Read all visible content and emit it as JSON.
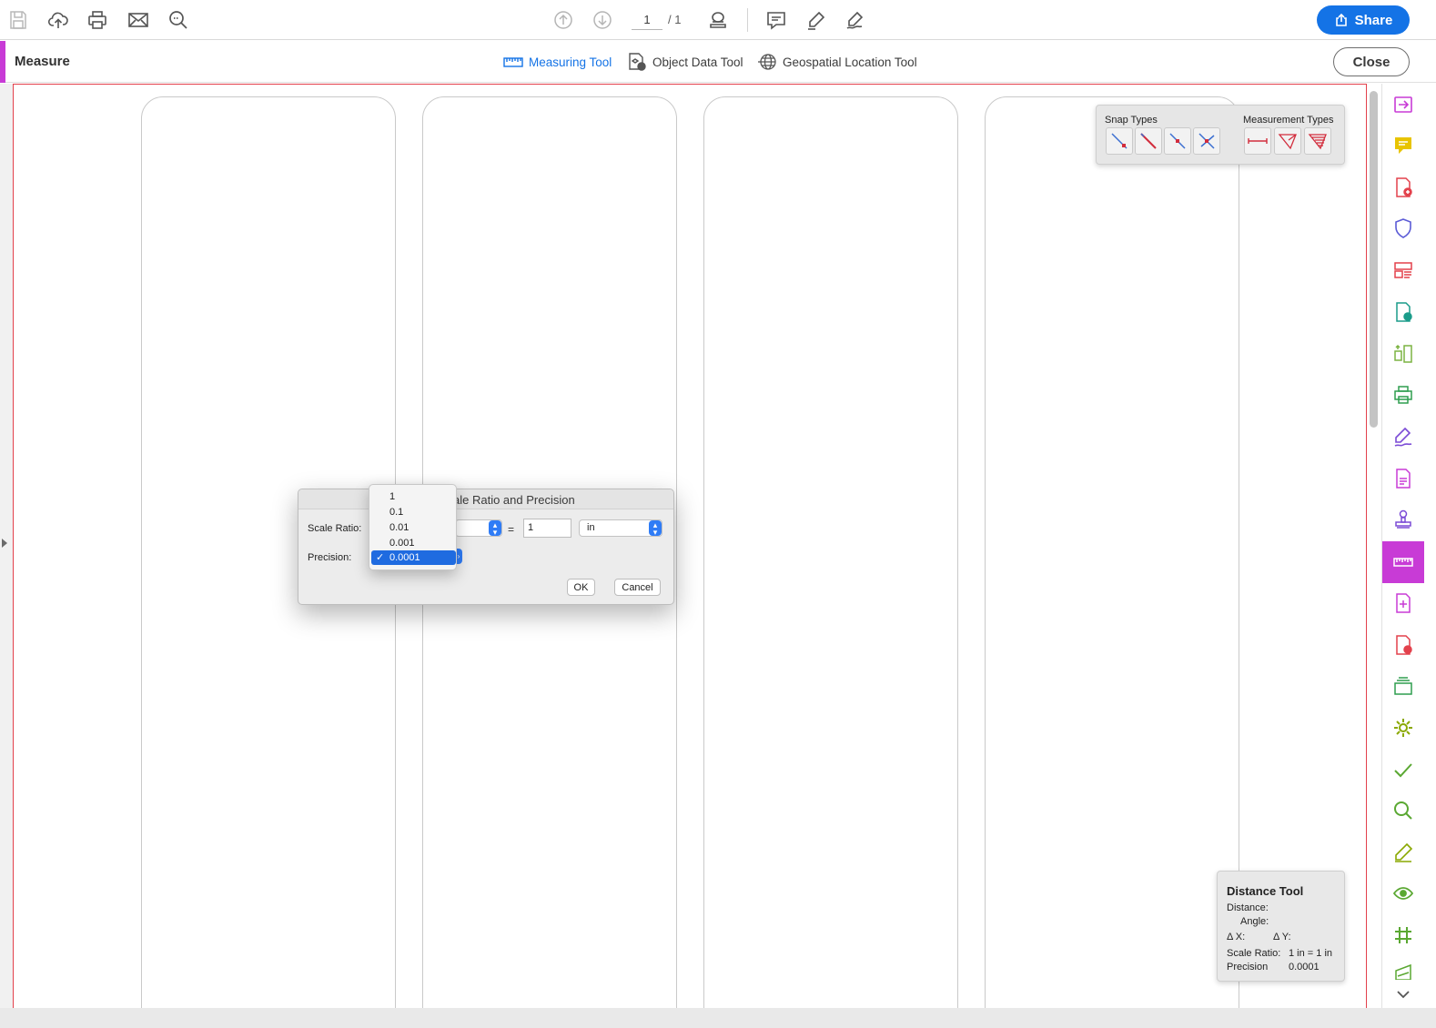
{
  "toolbar": {
    "icons": [
      "save-icon",
      "upload-icon",
      "print-icon",
      "mail-icon",
      "zoom-search-icon",
      "page-up-icon",
      "page-down-icon",
      "scroll-mode-icon",
      "comment-icon",
      "highlight-pen-icon",
      "sign-icon"
    ],
    "page_current": "1",
    "page_total": "/ 1",
    "share_label": "Share"
  },
  "measure_bar": {
    "title": "Measure",
    "tools": [
      {
        "label": "Measuring Tool",
        "icon": "ruler-icon",
        "active": true
      },
      {
        "label": "Object Data Tool",
        "icon": "object-data-icon",
        "active": false
      },
      {
        "label": "Geospatial Location Tool",
        "icon": "globe-icon",
        "active": false
      }
    ],
    "close_label": "Close"
  },
  "snap_panel": {
    "snap_label": "Snap Types",
    "measurement_label": "Measurement Types",
    "snap_icons": [
      "snap-endpoint-icon",
      "snap-path-icon",
      "snap-midpoint-icon",
      "snap-intersection-icon"
    ],
    "measurement_icons": [
      "distance-icon",
      "perimeter-icon",
      "area-icon"
    ]
  },
  "dialog": {
    "title": "ale Ratio and Precision",
    "scale_ratio_label": "Scale Ratio:",
    "precision_label": "Precision:",
    "equals": "=",
    "value": "1",
    "unit": "in",
    "ok_label": "OK",
    "cancel_label": "Cancel"
  },
  "precision_dropdown": {
    "options": [
      "1",
      "0.1",
      "0.01",
      "0.001",
      "0.0001"
    ],
    "selected": "0.0001",
    "check": "✓"
  },
  "distance_panel": {
    "title": "Distance Tool",
    "distance_label": "Distance:",
    "angle_label": "Angle:",
    "dx_label": "Δ X:",
    "dy_label": "Δ Y:",
    "scale_ratio_label": "Scale Ratio:",
    "scale_ratio_value": "1 in = 1 in",
    "precision_label": "Precision",
    "precision_value": "0.0001"
  },
  "sidebar": {
    "icons": [
      "export-pdf-icon",
      "comment-icon",
      "create-pdf-icon",
      "protect-icon",
      "organize-pages-icon",
      "send-for-review-icon",
      "compare-icon",
      "print-production-icon",
      "fill-sign-icon",
      "edit-pdf-icon",
      "stamp-icon",
      "measure-icon",
      "rich-media-icon",
      "pdf-standards-icon",
      "scan-ocr-icon",
      "action-wizard-icon",
      "certificates-icon",
      "redact-icon",
      "prepare-form-icon",
      "accessibility-icon",
      "index-icon",
      "more-tools-icon"
    ]
  }
}
